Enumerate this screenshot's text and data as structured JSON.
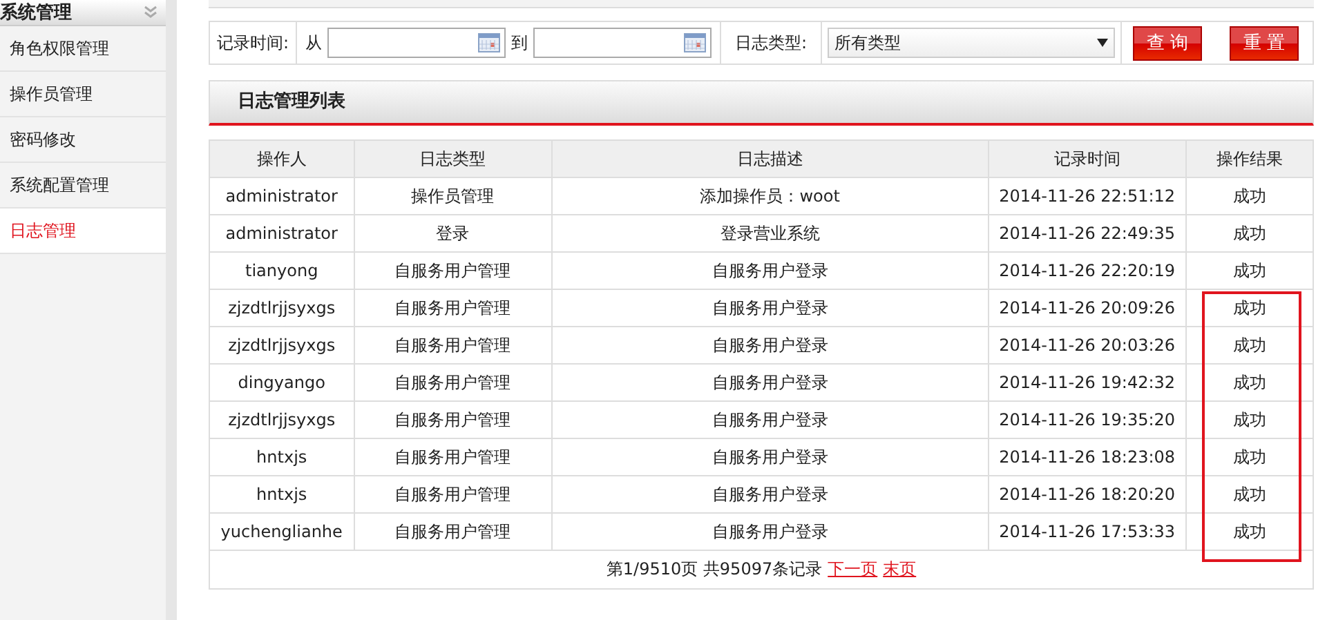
{
  "sidebar": {
    "header": "系统管理",
    "items": [
      {
        "label": "角色权限管理",
        "selected": false
      },
      {
        "label": "操作员管理",
        "selected": false
      },
      {
        "label": "密码修改",
        "selected": false
      },
      {
        "label": "系统配置管理",
        "selected": false
      },
      {
        "label": "日志管理",
        "selected": true
      }
    ]
  },
  "filter": {
    "time_label": "记录时间:",
    "from_label": "从",
    "to_label": "到",
    "type_label": "日志类型:",
    "type_value": "所有类型",
    "buttons": [
      "查 询",
      "重 置"
    ]
  },
  "panel": {
    "title": "日志管理列表"
  },
  "table": {
    "columns": [
      "操作人",
      "日志类型",
      "日志描述",
      "记录时间",
      "操作结果"
    ],
    "rows": [
      [
        "administrator",
        "操作员管理",
        "添加操作员：woot",
        "2014-11-26 22:51:12",
        "成功"
      ],
      [
        "administrator",
        "登录",
        "登录营业系统",
        "2014-11-26 22:49:35",
        "成功"
      ],
      [
        "tianyong",
        "自服务用户管理",
        "自服务用户登录",
        "2014-11-26 22:20:19",
        "成功"
      ],
      [
        "zjzdtlrjjsyxgs",
        "自服务用户管理",
        "自服务用户登录",
        "2014-11-26 20:09:26",
        "成功"
      ],
      [
        "zjzdtlrjjsyxgs",
        "自服务用户管理",
        "自服务用户登录",
        "2014-11-26 20:03:26",
        "成功"
      ],
      [
        "dingyango",
        "自服务用户管理",
        "自服务用户登录",
        "2014-11-26 19:42:32",
        "成功"
      ],
      [
        "zjzdtlrjjsyxgs",
        "自服务用户管理",
        "自服务用户登录",
        "2014-11-26 19:35:20",
        "成功"
      ],
      [
        "hntxjs",
        "自服务用户管理",
        "自服务用户登录",
        "2014-11-26 18:23:08",
        "成功"
      ],
      [
        "hntxjs",
        "自服务用户管理",
        "自服务用户登录",
        "2014-11-26 18:20:20",
        "成功"
      ],
      [
        "yuchenglianhe",
        "自服务用户管理",
        "自服务用户登录",
        "2014-11-26 17:53:33",
        "成功"
      ]
    ]
  },
  "pagination": {
    "summary": "第1/9510页 共95097条记录",
    "links": [
      "下一页",
      "末页"
    ]
  }
}
